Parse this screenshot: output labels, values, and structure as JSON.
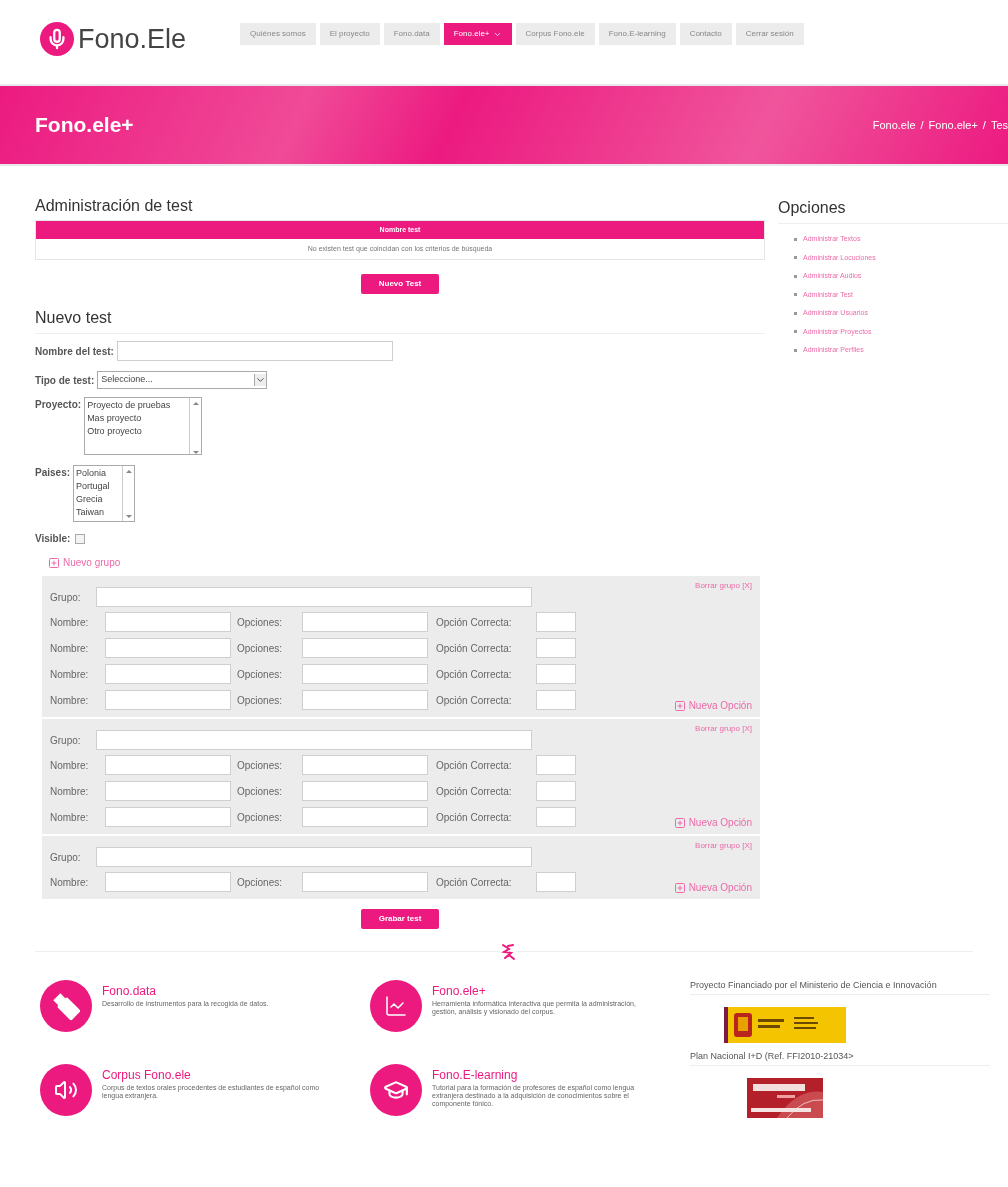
{
  "header": {
    "logo_text": "Fono.Ele",
    "nav": [
      {
        "label": "Quiénes somos",
        "selected": false
      },
      {
        "label": "El proyecto",
        "selected": false
      },
      {
        "label": "Fono.data",
        "selected": false
      },
      {
        "label": "Fono.ele+",
        "selected": true,
        "dropdown": true
      },
      {
        "label": "Corpus Fono.ele",
        "selected": false
      },
      {
        "label": "Fono.E-learning",
        "selected": false
      },
      {
        "label": "Contacto",
        "selected": false
      },
      {
        "label": "Cerrar sesión",
        "selected": false
      }
    ]
  },
  "banner": {
    "title": "Fono.ele+",
    "breadcrumb": [
      "Fono.ele",
      "/",
      "Fono.ele+",
      "/",
      "Tes"
    ]
  },
  "admin": {
    "heading": "Administración de test",
    "table": {
      "columns": [
        "Nombre test"
      ],
      "empty_message": "No existen test que coincidan con los criterios de búsqueda"
    },
    "new_button": "Nuevo Test"
  },
  "form": {
    "heading": "Nuevo test",
    "name_label": "Nombre del test:",
    "type_label": "Tipo de test:",
    "type_value": "Seleccione...",
    "project_label": "Proyecto:",
    "projects": [
      "Proyecto de pruebas",
      "Mas proyecto",
      "Otro proyecto"
    ],
    "countries_label": "Paises:",
    "countries": [
      "Polonia",
      "Portugal",
      "Grecia",
      "Taiwan"
    ],
    "visible_label": "Visible:",
    "visible_checked": false,
    "new_group": "Nuevo grupo",
    "groups": [
      {
        "delete": "Borrar grupo [X]",
        "group_label": "Grupo:",
        "new_option": "Nueva Opción",
        "rows": [
          {
            "name_label": "Nombre:",
            "options_label": "Opciones:",
            "correct_label": "Opción Correcta:"
          },
          {
            "name_label": "Nombre:",
            "options_label": "Opciones:",
            "correct_label": "Opción Correcta:"
          },
          {
            "name_label": "Nombre:",
            "options_label": "Opciones:",
            "correct_label": "Opción Correcta:"
          },
          {
            "name_label": "Nombre:",
            "options_label": "Opciones:",
            "correct_label": "Opción Correcta:"
          }
        ]
      },
      {
        "delete": "Borrar grupo [X]",
        "group_label": "Grupo:",
        "new_option": "Nueva Opción",
        "rows": [
          {
            "name_label": "Nombre:",
            "options_label": "Opciones:",
            "correct_label": "Opción Correcta:"
          },
          {
            "name_label": "Nombre:",
            "options_label": "Opciones:",
            "correct_label": "Opción Correcta:"
          },
          {
            "name_label": "Nombre:",
            "options_label": "Opciones:",
            "correct_label": "Opción Correcta:"
          }
        ]
      },
      {
        "delete": "Borrar grupo [X]",
        "group_label": "Grupo:",
        "new_option": "Nueva Opción",
        "rows": [
          {
            "name_label": "Nombre:",
            "options_label": "Opciones:",
            "correct_label": "Opción Correcta:"
          }
        ]
      }
    ],
    "save_button": "Grabar test"
  },
  "sidebar": {
    "heading": "Opciones",
    "items": [
      "Administrar Textos",
      "Administrar Locuciones",
      "Administrar Audios",
      "Administrar Test",
      "Administrar Usuarios",
      "Administrar Proyectos",
      "Administrar Perfiles"
    ]
  },
  "footer": {
    "features": [
      {
        "kind": "usb",
        "title": "Fono.data",
        "description": "Desarrollo de instrumentos para la recogida de datos."
      },
      {
        "kind": "chart",
        "title": "Fono.ele+",
        "description": "Herramienta informática interactiva que permita la administración, gestión, análisis y visionado del corpus."
      },
      {
        "kind": "speaker",
        "title": "Corpus Fono.ele",
        "description": "Corpus de textos orales procedentes de estudiantes de español como lengua extranjera."
      },
      {
        "kind": "cap",
        "title": "Fono.E-learning",
        "description": "Tutorial para la formación de profesores de español como lengua extranjera destinado a la adquisición de conocimientos sobre el componente fónico."
      }
    ],
    "funding": [
      {
        "text": "Proyecto Financiado por el Ministerio de Ciencia e Innovación",
        "kind": "gov"
      },
      {
        "text": "Plan Nacional I+D (Ref. FFI2010-21034>",
        "kind": "plan"
      }
    ]
  }
}
